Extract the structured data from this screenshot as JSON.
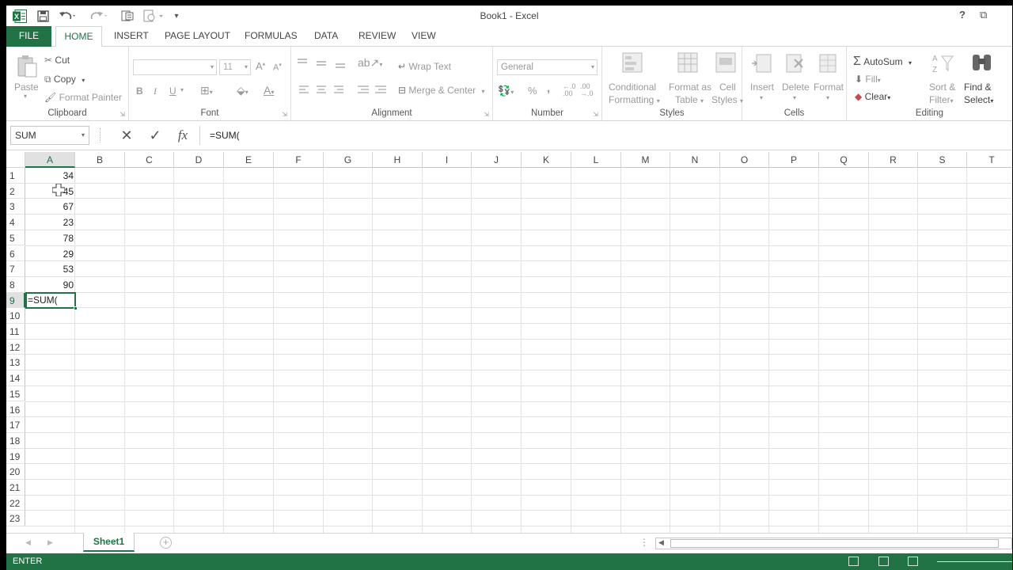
{
  "window": {
    "title": "Book1 - Excel",
    "help": "?",
    "restore": "⧉"
  },
  "ribbon_tabs": [
    "FILE",
    "HOME",
    "INSERT",
    "PAGE LAYOUT",
    "FORMULAS",
    "DATA",
    "REVIEW",
    "VIEW"
  ],
  "clipboard": {
    "paste": "Paste",
    "cut": "Cut",
    "copy": "Copy",
    "format_painter": "Format Painter",
    "label": "Clipboard"
  },
  "font": {
    "size": "11",
    "bold": "B",
    "italic": "I",
    "underline": "U",
    "label": "Font"
  },
  "alignment": {
    "wrap_text": "Wrap Text",
    "merge_center": "Merge & Center",
    "label": "Alignment"
  },
  "number": {
    "format": "General",
    "percent": "%",
    "comma": ",",
    "inc_decimal": "←.0\n.00",
    "dec_decimal": ".00\n→.0",
    "label": "Number"
  },
  "styles": {
    "conditional": "Conditional",
    "conditional2": "Formatting",
    "format_as": "Format as",
    "format_as2": "Table",
    "cell": "Cell",
    "cell2": "Styles",
    "label": "Styles"
  },
  "cells": {
    "insert": "Insert",
    "delete": "Delete",
    "format": "Format",
    "label": "Cells"
  },
  "editing": {
    "autosum": "AutoSum",
    "fill": "Fill",
    "clear": "Clear",
    "sort": "Sort &",
    "sort2": "Filter",
    "find": "Find &",
    "find2": "Select",
    "label": "Editing"
  },
  "formula_bar": {
    "name_box": "SUM",
    "formula": "=SUM("
  },
  "columns": [
    "A",
    "B",
    "C",
    "D",
    "E",
    "F",
    "G",
    "H",
    "I",
    "J",
    "K",
    "L",
    "M",
    "N",
    "O",
    "P",
    "Q",
    "R",
    "S",
    "T"
  ],
  "rows": [
    "1",
    "2",
    "3",
    "4",
    "5",
    "6",
    "7",
    "8",
    "9",
    "10",
    "11",
    "12",
    "13",
    "14",
    "15",
    "16",
    "17",
    "18",
    "19",
    "20",
    "21",
    "22",
    "23"
  ],
  "values_col_a": [
    "34",
    "45",
    "67",
    "23",
    "78",
    "29",
    "53",
    "90"
  ],
  "active_cell": {
    "ref": "A9",
    "content": "=SUM("
  },
  "sheets": {
    "active": "Sheet1"
  },
  "status": {
    "mode": "ENTER"
  },
  "colors": {
    "accent": "#217346"
  }
}
